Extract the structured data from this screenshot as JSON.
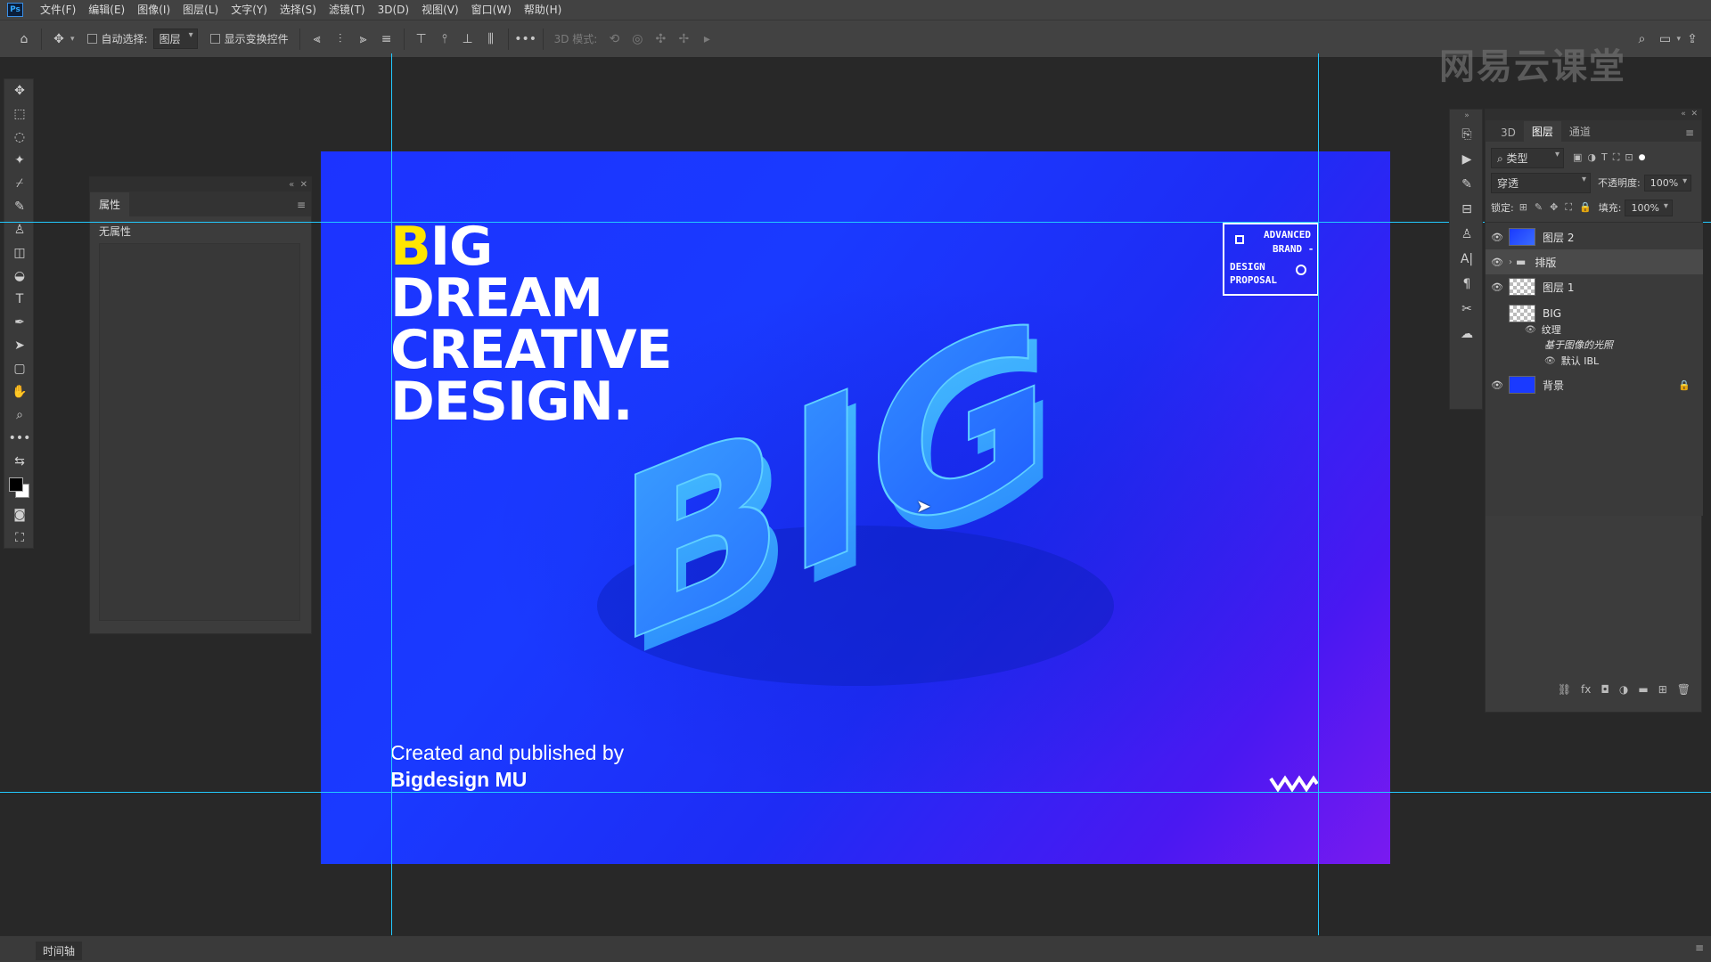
{
  "menubar": {
    "app_icon": "Ps",
    "items": [
      "文件(F)",
      "编辑(E)",
      "图像(I)",
      "图层(L)",
      "文字(Y)",
      "选择(S)",
      "滤镜(T)",
      "3D(D)",
      "视图(V)",
      "窗口(W)",
      "帮助(H)"
    ]
  },
  "options": {
    "auto_select_label": "自动选择:",
    "auto_select_value": "图层",
    "show_transform_label": "显示变换控件",
    "mode3d_label": "3D 模式:"
  },
  "watermark": "网易云课堂",
  "properties": {
    "tab": "属性",
    "no_props": "无属性"
  },
  "canvas": {
    "headline": {
      "b": "B",
      "line1_rest": "IG",
      "line2": "DREAM",
      "line3": "CREATIVE",
      "line4": "DESIGN."
    },
    "art_text": "BIG",
    "badge": {
      "l1": "ADVANCED",
      "l2": "BRAND -",
      "l3": "DESIGN",
      "l4": "PROPOSAL"
    },
    "credits_line1": "Created and published by",
    "credits_line2": "Bigdesign MU"
  },
  "layers_panel": {
    "tabs": [
      "3D",
      "图层",
      "通道"
    ],
    "active_tab": "图层",
    "filter_label": "类型",
    "blend_mode": "穿透",
    "opacity_label": "不透明度:",
    "opacity_value": "100%",
    "lock_label": "锁定:",
    "fill_label": "填充:",
    "fill_value": "100%",
    "layers": [
      {
        "name": "图层 2"
      },
      {
        "name": "排版"
      },
      {
        "name": "图层 1"
      },
      {
        "name": "BIG"
      },
      {
        "name": "纹理"
      },
      {
        "name": "基于图像的光照"
      },
      {
        "name": "默认 IBL"
      },
      {
        "name": "背景"
      }
    ]
  },
  "status": {
    "timeline": "时间轴"
  },
  "colors": {
    "canvas_blue": "#1c33ff",
    "canvas_purple": "#7a1af0",
    "headline_accent": "#ffe500",
    "guide": "#22c9ff"
  }
}
